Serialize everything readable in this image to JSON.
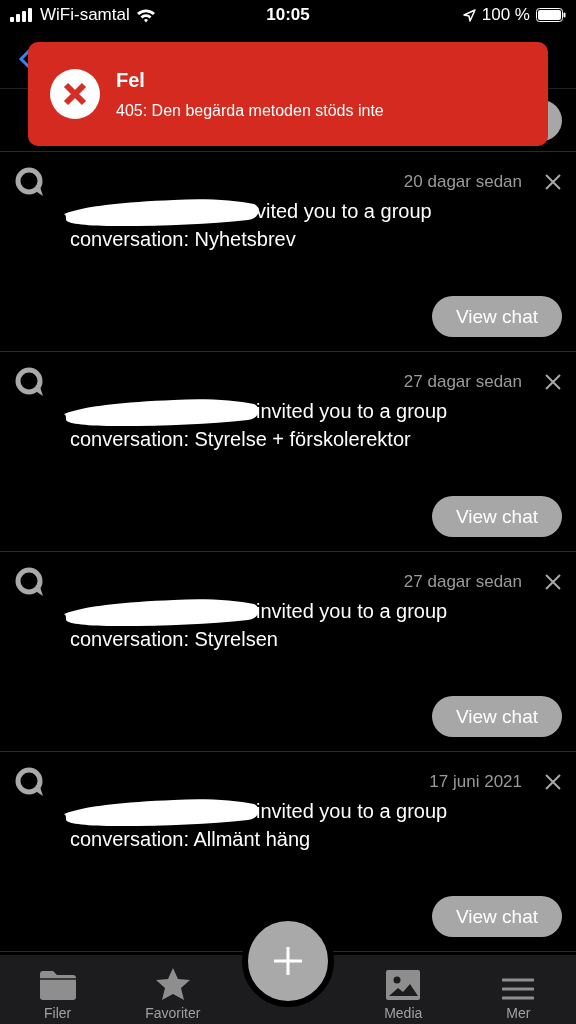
{
  "status_bar": {
    "carrier": "WiFi-samtal",
    "time": "10:05",
    "battery": "100 %"
  },
  "toast": {
    "title": "Fel",
    "message": "405: Den begärda metoden stöds inte"
  },
  "notifications": [
    {
      "time": "20 dagar sedan",
      "line1": "vited you to a group",
      "line2": "conversation: Nyhetsbrev",
      "button": "View chat"
    },
    {
      "time": "27 dagar sedan",
      "line1": "invited you to a group",
      "line2": "conversation: Styrelse + förskolerektor",
      "button": "View chat"
    },
    {
      "time": "27 dagar sedan",
      "line1": "invited you to a group",
      "line2": "conversation: Styrelsen",
      "button": "View chat"
    },
    {
      "time": "17 juni 2021",
      "line1": "invited you to a group",
      "line2": "conversation: Allmänt häng",
      "button": "View chat"
    }
  ],
  "tab_bar": [
    {
      "kind": "folder",
      "label": "Filer"
    },
    {
      "kind": "star",
      "label": "Favoriter"
    },
    {
      "kind": "fab"
    },
    {
      "kind": "image",
      "label": "Media"
    },
    {
      "kind": "menu",
      "label": "Mer"
    }
  ]
}
